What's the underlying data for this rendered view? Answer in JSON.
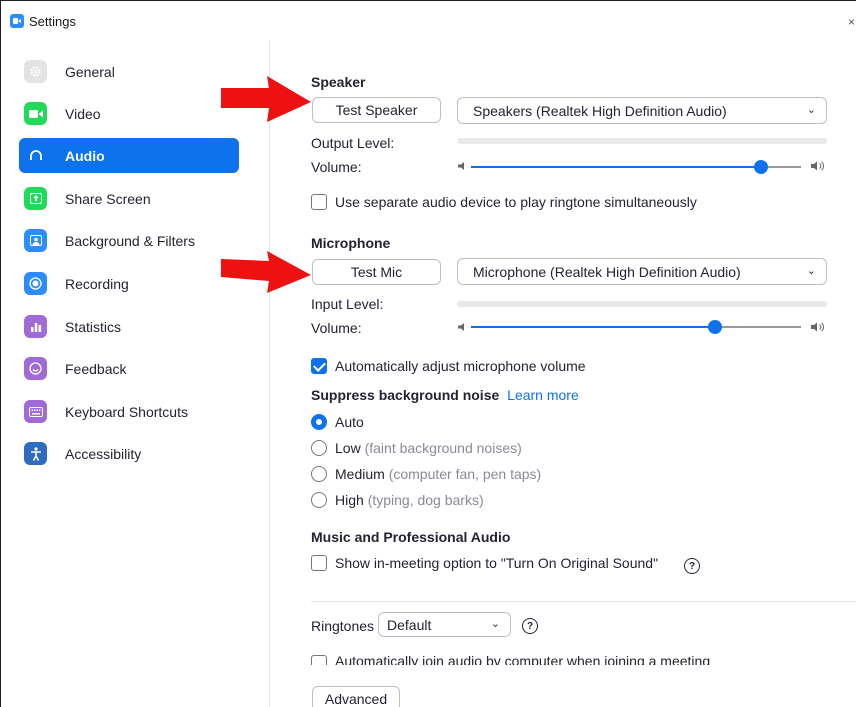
{
  "window": {
    "title": "Settings",
    "close": "×"
  },
  "sidebar": {
    "items": [
      {
        "label": "General",
        "icon": "gear-icon",
        "color": "#e3e3e3",
        "active": false
      },
      {
        "label": "Video",
        "icon": "video-icon",
        "color": "#23d959",
        "active": false
      },
      {
        "label": "Audio",
        "icon": "headphones-icon",
        "color": "#0e72ed",
        "active": true
      },
      {
        "label": "Share Screen",
        "icon": "share-screen-icon",
        "color": "#23d959",
        "active": false
      },
      {
        "label": "Background & Filters",
        "icon": "background-icon",
        "color": "#2d8cff",
        "active": false
      },
      {
        "label": "Recording",
        "icon": "recording-icon",
        "color": "#2d8cff",
        "active": false
      },
      {
        "label": "Statistics",
        "icon": "statistics-icon",
        "color": "#a06bd6",
        "active": false
      },
      {
        "label": "Feedback",
        "icon": "feedback-icon",
        "color": "#a06bd6",
        "active": false
      },
      {
        "label": "Keyboard Shortcuts",
        "icon": "keyboard-icon",
        "color": "#a06bd6",
        "active": false
      },
      {
        "label": "Accessibility",
        "icon": "accessibility-icon",
        "color": "#2d6cc0",
        "active": false
      }
    ]
  },
  "speaker": {
    "title": "Speaker",
    "test_button": "Test Speaker",
    "device": "Speakers (Realtek High Definition Audio)",
    "output_level_label": "Output Level:",
    "volume_label": "Volume:",
    "volume": 0.88
  },
  "ringtone_checkbox": {
    "label": "Use separate audio device to play ringtone simultaneously",
    "checked": false
  },
  "microphone": {
    "title": "Microphone",
    "test_button": "Test Mic",
    "device": "Microphone (Realtek High Definition Audio)",
    "input_level_label": "Input Level:",
    "volume_label": "Volume:",
    "volume": 0.74
  },
  "auto_adjust": {
    "label": "Automatically adjust microphone volume",
    "checked": true
  },
  "noise": {
    "title": "Suppress background noise",
    "learn_more": "Learn more",
    "options": [
      {
        "label": "Auto",
        "hint": "",
        "selected": true
      },
      {
        "label": "Low",
        "hint": "(faint background noises)",
        "selected": false
      },
      {
        "label": "Medium",
        "hint": "(computer fan, pen taps)",
        "selected": false
      },
      {
        "label": "High",
        "hint": "(typing, dog barks)",
        "selected": false
      }
    ]
  },
  "music": {
    "title": "Music and Professional Audio",
    "original_sound_label": "Show in-meeting option to \"Turn On Original Sound\"",
    "checked": false,
    "help": "?"
  },
  "ringtones": {
    "label": "Ringtones",
    "value": "Default",
    "help": "?"
  },
  "auto_join": {
    "label": "Automatically join audio by computer when joining a meeting",
    "checked": false
  },
  "advanced_button": "Advanced",
  "colors": {
    "accent": "#0e72ed",
    "annotation_arrow": "#ee1111"
  }
}
